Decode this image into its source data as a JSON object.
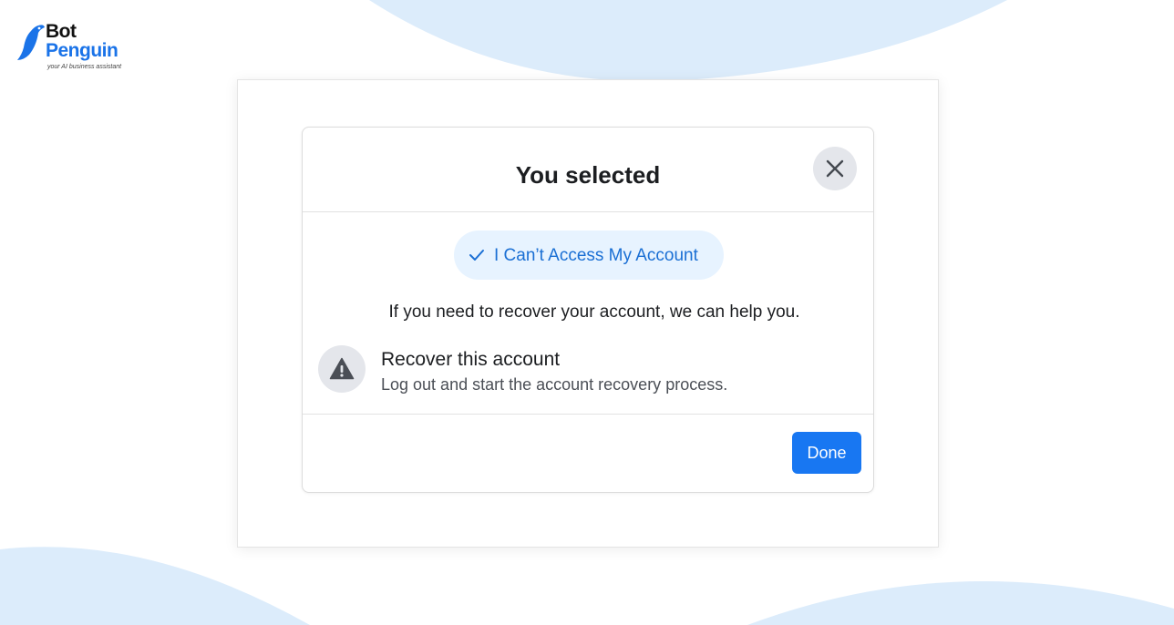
{
  "logo": {
    "name_line1": "Bot",
    "name_line2": "Penguin",
    "tagline": "your AI business assistant"
  },
  "dialog": {
    "title": "You selected",
    "selected_option": "I Can’t Access My Account",
    "info_text": "If you need to recover your account, we can help you.",
    "option": {
      "title": "Recover this account",
      "description": "Log out and start the account recovery process."
    },
    "done_label": "Done"
  },
  "icons": {
    "close": "close-icon",
    "check": "check-icon",
    "warning": "warning-icon",
    "logo": "penguin-logo-icon"
  },
  "colors": {
    "background_wave": "#dcecfb",
    "accent_blue": "#1877f2",
    "pill_background": "#e7f3ff",
    "pill_text": "#1a6fd4",
    "icon_circle": "#e4e6eb"
  }
}
